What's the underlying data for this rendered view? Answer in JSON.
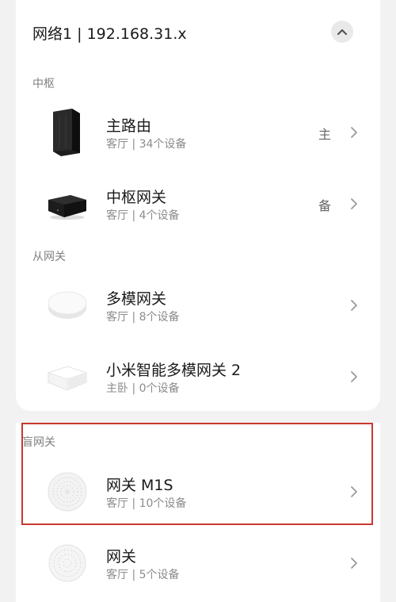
{
  "network": {
    "title": "网络1 | 192.168.31.x"
  },
  "sections": {
    "hub": "中枢",
    "secondary": "从网关",
    "bluetooth": "盲网关"
  },
  "devices": [
    {
      "name": "主路由",
      "location_count": "客厅 | 34个设备",
      "role": "主",
      "icon": "router-icon"
    },
    {
      "name": "中枢网关",
      "location_count": "客厅 | 4个设备",
      "role": "备",
      "icon": "hub-gateway-icon"
    },
    {
      "name": "多模网关",
      "location_count": "客厅 | 8个设备",
      "role": "",
      "icon": "multimode-gateway-icon"
    },
    {
      "name": "小米智能多模网关 2",
      "location_count": "主卧 | 0个设备",
      "role": "",
      "icon": "multimode-gateway-2-icon"
    },
    {
      "name": "网关 M1S",
      "location_count": "客厅 | 10个设备",
      "role": "",
      "icon": "gateway-m1s-icon"
    },
    {
      "name": "网关",
      "location_count": "客厅 | 5个设备",
      "role": "",
      "icon": "gateway-icon"
    }
  ],
  "colors": {
    "background": "#f2f2f2",
    "card": "#ffffff",
    "highlight": "#c8382e"
  }
}
